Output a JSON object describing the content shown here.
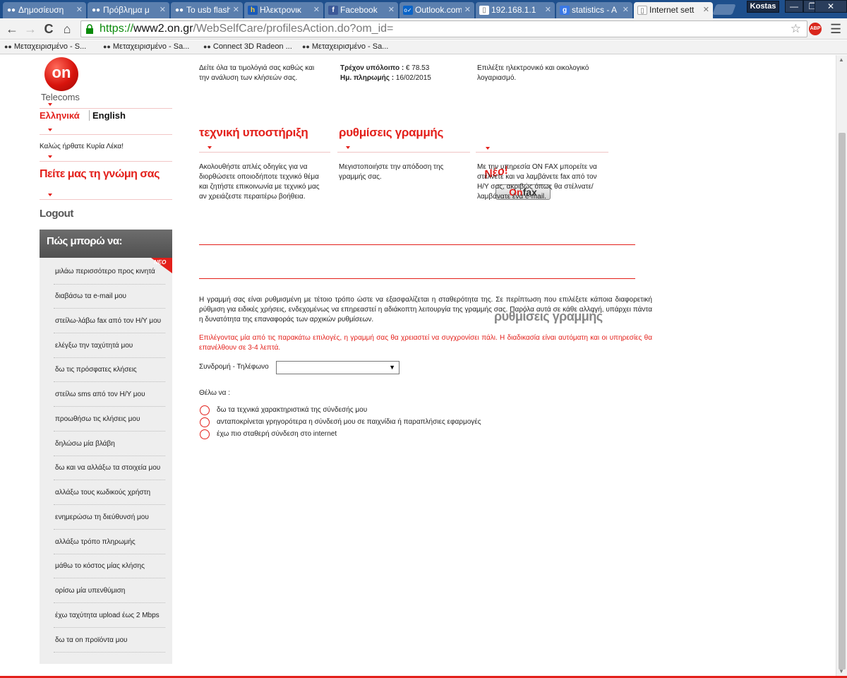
{
  "browser": {
    "tabs": [
      {
        "label": "Δημοσίευση",
        "favicon": "sa-icon",
        "fav_color": "#fff"
      },
      {
        "label": "Πρόβλημα μ",
        "favicon": "sa-icon",
        "fav_color": "#fff"
      },
      {
        "label": "To usb flash",
        "favicon": "sa-icon",
        "fav_color": "#fff"
      },
      {
        "label": "Ηλεκτρονικ",
        "favicon": "h-icon",
        "fav_color": "#1a5ab8"
      },
      {
        "label": "Facebook",
        "favicon": "facebook-icon",
        "fav_color": "#3b5998"
      },
      {
        "label": "Outlook.com",
        "favicon": "outlook-icon",
        "fav_color": "#0a64c8"
      },
      {
        "label": "192.168.1.1",
        "favicon": "page-icon",
        "fav_color": "#fff"
      },
      {
        "label": "statistics - A",
        "favicon": "google-icon",
        "fav_color": "#3a78e6"
      },
      {
        "label": "Internet sett",
        "favicon": "page-icon",
        "fav_color": "#fff",
        "active": true
      }
    ],
    "user": "Kostas",
    "window_buttons": {
      "minimize": "—",
      "restore": "❐",
      "close": "✕"
    },
    "url": {
      "scheme": "https://",
      "host": "www2.on.gr",
      "path": "/WebSelfCare/profilesAction.do?om_id="
    },
    "abp_label": "ABP",
    "bookmarks": [
      "Μεταχειρισμένο - S...",
      "Μεταχειρισμένο - Sa...",
      "Connect 3D Radeon ...",
      "Μεταχειρισμένο - Sa..."
    ]
  },
  "sidebar": {
    "logo": "on",
    "logo_sub": "Telecoms",
    "lang_el": "Ελληνικά",
    "lang_en": "English",
    "welcome": "Καλώς ήρθατε Κυρία Λέκα!",
    "opinion": "Πείτε μας τη γνώμη σας",
    "logout": "Logout",
    "how_can": "Πώς μπορώ να:",
    "neo_badge": "ΝΕΟ",
    "menu_items": [
      "μιλάω περισσότερο προς κινητά",
      "διαβάσω τα e-mail μου",
      "στείλω-λάβω fax από τον Η/Υ μου",
      "ελέγξω την ταχύτητά μου",
      "δω τις πρόσφατες κλήσεις",
      "στείλω sms από τον Η/Υ μου",
      "προωθήσω τις κλήσεις μου",
      "δηλώσω μία βλάβη",
      "δω και να αλλάξω τα στοιχεία μου",
      "αλλάξω τους κωδικούς χρήστη",
      "ενημερώσω τη διεύθυνσή μου",
      "αλλάξω τρόπο πληρωμής",
      "μάθω το κόστος μίας κλήσης",
      "ορίσω μία υπενθύμιση",
      "έχω ταχύτητα upload έως 2 Mbps",
      "δω τα on προϊόντα μου"
    ]
  },
  "top": {
    "bills_line1": "Δείτε όλα τα τιμολόγιά σας καθώς και",
    "bills_line2": "την ανάλυση των κλήσεών σας.",
    "balance_label": "Τρέχον υπόλοιπο :",
    "balance_value": " € 78.53",
    "due_label": "Ημ. πληρωμής :",
    "due_value": " 16/02/2015",
    "eaccount_line1": "Επιλέξτε ηλεκτρονικό και οικολογικό",
    "eaccount_line2": "λογαριασμό."
  },
  "sections": [
    {
      "title": "τεχνική υποστήριξη",
      "lines": [
        "Ακολουθήστε απλές οδηγίες για να",
        "διορθώσετε οποιοδήποτε τεχνικό θέμα",
        "και ζητήστε επικοινωνία με τεχνικό μας",
        "αν χρειάζεστε περαιτέρω βοήθεια."
      ]
    },
    {
      "title": "ρυθμίσεις γραμμής",
      "lines": [
        "Μεγιστοποιήστε την απόδοση της",
        "γραμμής σας."
      ]
    },
    {
      "title_neo": "Νέο!",
      "button_on": "On",
      "button_fax": "fax",
      "lines": [
        "Με την υπηρεσία ON FAX μπορείτε να",
        "στέλνετε και να λαμβάνετε fax από τον",
        "Η/Υ σας, ακριβώς όπως θα στέλνατε/",
        "λαμβάνατε ένα e-mail."
      ]
    }
  ],
  "line_settings": {
    "heading": "ρυθμίσεις γραμμής",
    "intro": "Η γραμμή σας είναι ρυθμισμένη με τέτοιο τρόπο ώστε να εξασφαλίζεται η σταθερότητα της. Σε περίπτωση που επιλέξετε κάποια διαφορετική ρύθμιση για ειδικές χρήσεις, ενδεχομένως να επηρεαστεί η αδιάκοπτη λειτουργία της γραμμής σας. Παρόλα αυτά σε κάθε αλλαγή, υπάρχει πάντα η δυνατότητα της επαναφοράς των αρχικών ρυθμίσεων.",
    "warning": "Επιλέγοντας μία από τις παρακάτω επιλογές, η γραμμή σας θα χρειαστεί να συγχρονίσει πάλι. Η διαδικασία είναι αυτόματη και οι υπηρεσίες θα επανέλθουν σε 3-4 λεπτά.",
    "select_label": "Συνδρομή - Τηλέφωνο",
    "select_value": "",
    "want_label": "Θέλω να :",
    "options": [
      "δω τα τεχνικά χαρακτηριστικά της σύνδεσής μου",
      "ανταποκρίνεται γρηγορότερα η σύνδεσή μου σε παιχνίδια ή παραπλήσιες εφαρμογές",
      "έχω πιο σταθερή σύνδεση στο internet"
    ]
  },
  "colors": {
    "brand_red": "#e3201b",
    "sidebar_grey": "#eeeeee",
    "chrome_blue": "#1e4f8c"
  }
}
